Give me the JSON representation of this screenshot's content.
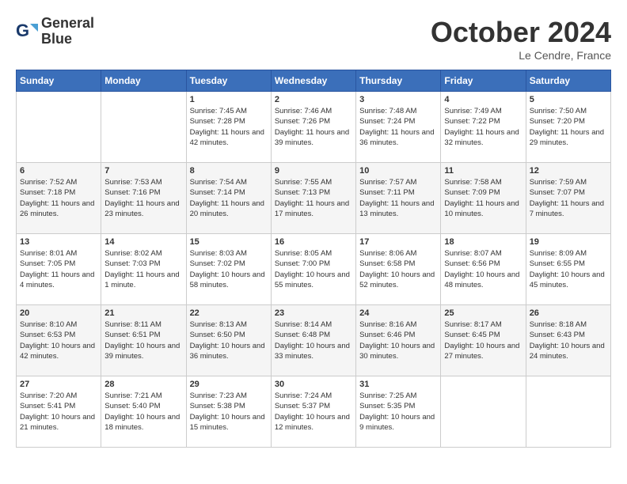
{
  "header": {
    "logo_line1": "General",
    "logo_line2": "Blue",
    "month": "October 2024",
    "location": "Le Cendre, France"
  },
  "days_of_week": [
    "Sunday",
    "Monday",
    "Tuesday",
    "Wednesday",
    "Thursday",
    "Friday",
    "Saturday"
  ],
  "weeks": [
    [
      {
        "num": "",
        "sunrise": "",
        "sunset": "",
        "daylight": ""
      },
      {
        "num": "",
        "sunrise": "",
        "sunset": "",
        "daylight": ""
      },
      {
        "num": "1",
        "sunrise": "Sunrise: 7:45 AM",
        "sunset": "Sunset: 7:28 PM",
        "daylight": "Daylight: 11 hours and 42 minutes."
      },
      {
        "num": "2",
        "sunrise": "Sunrise: 7:46 AM",
        "sunset": "Sunset: 7:26 PM",
        "daylight": "Daylight: 11 hours and 39 minutes."
      },
      {
        "num": "3",
        "sunrise": "Sunrise: 7:48 AM",
        "sunset": "Sunset: 7:24 PM",
        "daylight": "Daylight: 11 hours and 36 minutes."
      },
      {
        "num": "4",
        "sunrise": "Sunrise: 7:49 AM",
        "sunset": "Sunset: 7:22 PM",
        "daylight": "Daylight: 11 hours and 32 minutes."
      },
      {
        "num": "5",
        "sunrise": "Sunrise: 7:50 AM",
        "sunset": "Sunset: 7:20 PM",
        "daylight": "Daylight: 11 hours and 29 minutes."
      }
    ],
    [
      {
        "num": "6",
        "sunrise": "Sunrise: 7:52 AM",
        "sunset": "Sunset: 7:18 PM",
        "daylight": "Daylight: 11 hours and 26 minutes."
      },
      {
        "num": "7",
        "sunrise": "Sunrise: 7:53 AM",
        "sunset": "Sunset: 7:16 PM",
        "daylight": "Daylight: 11 hours and 23 minutes."
      },
      {
        "num": "8",
        "sunrise": "Sunrise: 7:54 AM",
        "sunset": "Sunset: 7:14 PM",
        "daylight": "Daylight: 11 hours and 20 minutes."
      },
      {
        "num": "9",
        "sunrise": "Sunrise: 7:55 AM",
        "sunset": "Sunset: 7:13 PM",
        "daylight": "Daylight: 11 hours and 17 minutes."
      },
      {
        "num": "10",
        "sunrise": "Sunrise: 7:57 AM",
        "sunset": "Sunset: 7:11 PM",
        "daylight": "Daylight: 11 hours and 13 minutes."
      },
      {
        "num": "11",
        "sunrise": "Sunrise: 7:58 AM",
        "sunset": "Sunset: 7:09 PM",
        "daylight": "Daylight: 11 hours and 10 minutes."
      },
      {
        "num": "12",
        "sunrise": "Sunrise: 7:59 AM",
        "sunset": "Sunset: 7:07 PM",
        "daylight": "Daylight: 11 hours and 7 minutes."
      }
    ],
    [
      {
        "num": "13",
        "sunrise": "Sunrise: 8:01 AM",
        "sunset": "Sunset: 7:05 PM",
        "daylight": "Daylight: 11 hours and 4 minutes."
      },
      {
        "num": "14",
        "sunrise": "Sunrise: 8:02 AM",
        "sunset": "Sunset: 7:03 PM",
        "daylight": "Daylight: 11 hours and 1 minute."
      },
      {
        "num": "15",
        "sunrise": "Sunrise: 8:03 AM",
        "sunset": "Sunset: 7:02 PM",
        "daylight": "Daylight: 10 hours and 58 minutes."
      },
      {
        "num": "16",
        "sunrise": "Sunrise: 8:05 AM",
        "sunset": "Sunset: 7:00 PM",
        "daylight": "Daylight: 10 hours and 55 minutes."
      },
      {
        "num": "17",
        "sunrise": "Sunrise: 8:06 AM",
        "sunset": "Sunset: 6:58 PM",
        "daylight": "Daylight: 10 hours and 52 minutes."
      },
      {
        "num": "18",
        "sunrise": "Sunrise: 8:07 AM",
        "sunset": "Sunset: 6:56 PM",
        "daylight": "Daylight: 10 hours and 48 minutes."
      },
      {
        "num": "19",
        "sunrise": "Sunrise: 8:09 AM",
        "sunset": "Sunset: 6:55 PM",
        "daylight": "Daylight: 10 hours and 45 minutes."
      }
    ],
    [
      {
        "num": "20",
        "sunrise": "Sunrise: 8:10 AM",
        "sunset": "Sunset: 6:53 PM",
        "daylight": "Daylight: 10 hours and 42 minutes."
      },
      {
        "num": "21",
        "sunrise": "Sunrise: 8:11 AM",
        "sunset": "Sunset: 6:51 PM",
        "daylight": "Daylight: 10 hours and 39 minutes."
      },
      {
        "num": "22",
        "sunrise": "Sunrise: 8:13 AM",
        "sunset": "Sunset: 6:50 PM",
        "daylight": "Daylight: 10 hours and 36 minutes."
      },
      {
        "num": "23",
        "sunrise": "Sunrise: 8:14 AM",
        "sunset": "Sunset: 6:48 PM",
        "daylight": "Daylight: 10 hours and 33 minutes."
      },
      {
        "num": "24",
        "sunrise": "Sunrise: 8:16 AM",
        "sunset": "Sunset: 6:46 PM",
        "daylight": "Daylight: 10 hours and 30 minutes."
      },
      {
        "num": "25",
        "sunrise": "Sunrise: 8:17 AM",
        "sunset": "Sunset: 6:45 PM",
        "daylight": "Daylight: 10 hours and 27 minutes."
      },
      {
        "num": "26",
        "sunrise": "Sunrise: 8:18 AM",
        "sunset": "Sunset: 6:43 PM",
        "daylight": "Daylight: 10 hours and 24 minutes."
      }
    ],
    [
      {
        "num": "27",
        "sunrise": "Sunrise: 7:20 AM",
        "sunset": "Sunset: 5:41 PM",
        "daylight": "Daylight: 10 hours and 21 minutes."
      },
      {
        "num": "28",
        "sunrise": "Sunrise: 7:21 AM",
        "sunset": "Sunset: 5:40 PM",
        "daylight": "Daylight: 10 hours and 18 minutes."
      },
      {
        "num": "29",
        "sunrise": "Sunrise: 7:23 AM",
        "sunset": "Sunset: 5:38 PM",
        "daylight": "Daylight: 10 hours and 15 minutes."
      },
      {
        "num": "30",
        "sunrise": "Sunrise: 7:24 AM",
        "sunset": "Sunset: 5:37 PM",
        "daylight": "Daylight: 10 hours and 12 minutes."
      },
      {
        "num": "31",
        "sunrise": "Sunrise: 7:25 AM",
        "sunset": "Sunset: 5:35 PM",
        "daylight": "Daylight: 10 hours and 9 minutes."
      },
      {
        "num": "",
        "sunrise": "",
        "sunset": "",
        "daylight": ""
      },
      {
        "num": "",
        "sunrise": "",
        "sunset": "",
        "daylight": ""
      }
    ]
  ]
}
